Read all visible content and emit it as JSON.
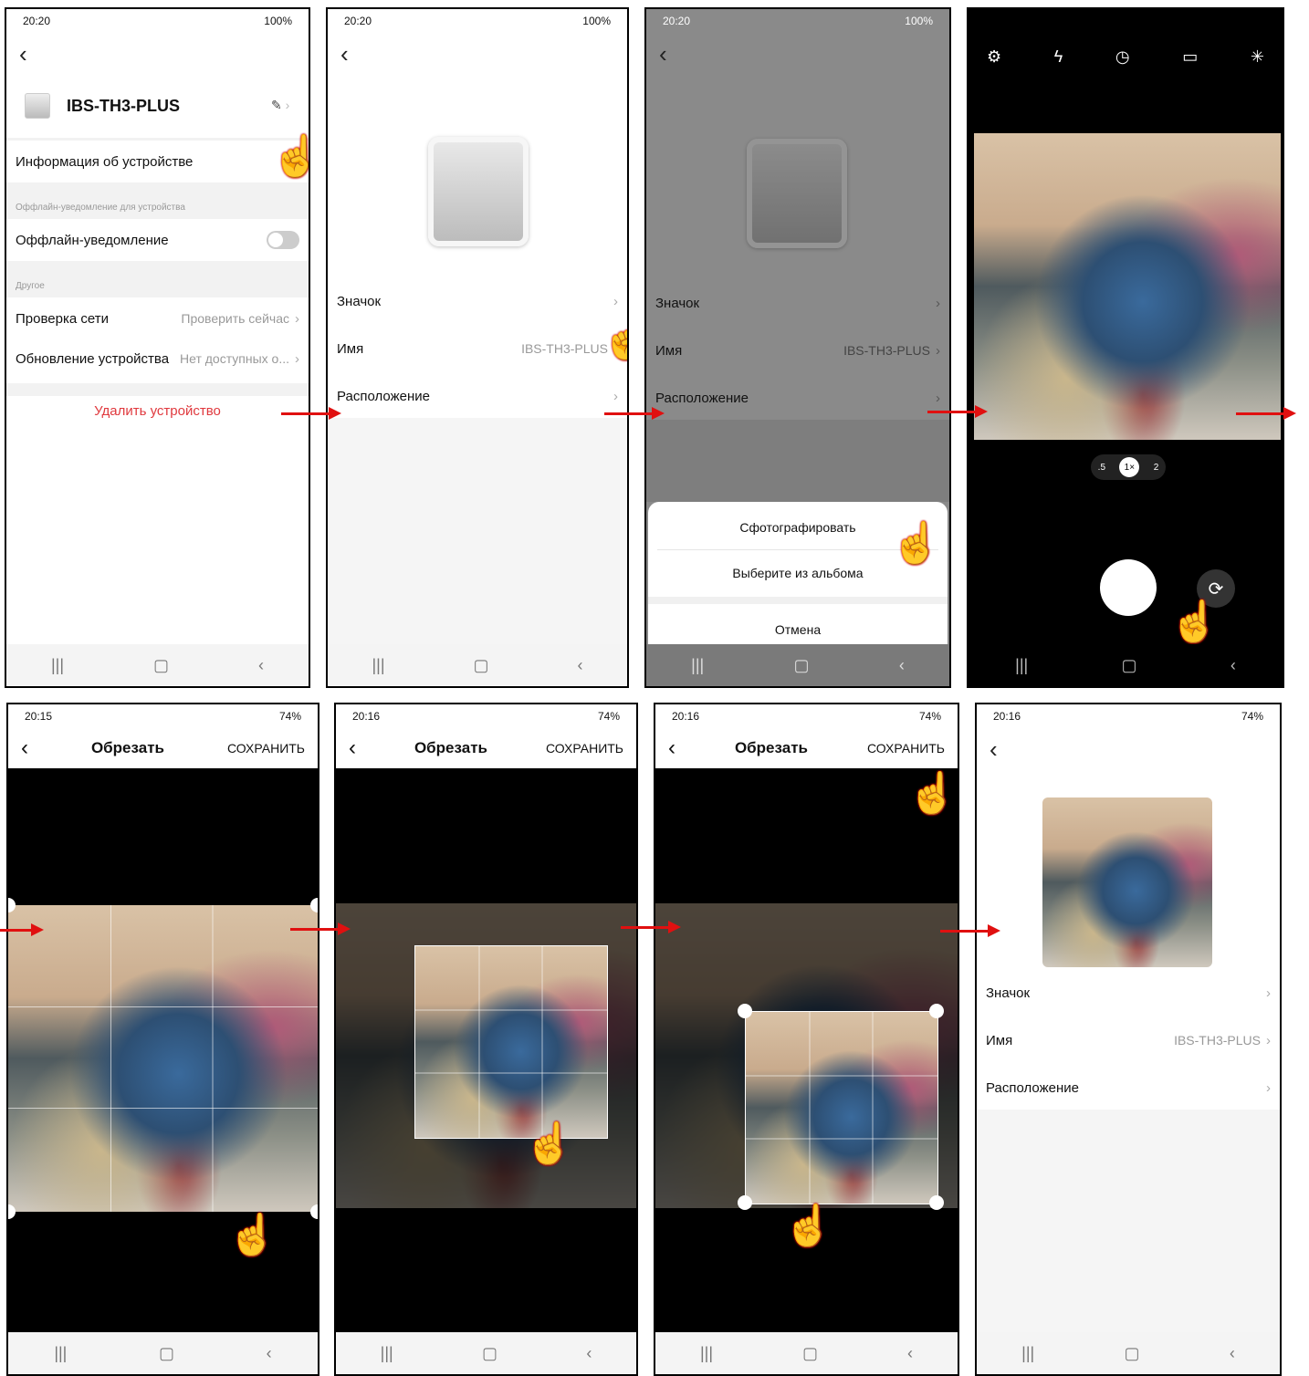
{
  "panels": {
    "p1": {
      "time": "20:20",
      "battery": "100%",
      "device_name": "IBS-TH3-PLUS",
      "info": "Информация об устройстве",
      "offline_section": "Оффлайн-уведомление для устройства",
      "offline_label": "Оффлайн-уведомление",
      "other_section": "Другое",
      "network_check": "Проверка сети",
      "network_check_value": "Проверить сейчас",
      "update": "Обновление устройства",
      "update_value": "Нет доступных о...",
      "delete": "Удалить устройство"
    },
    "p2": {
      "time": "20:20",
      "battery": "100%",
      "icon_label": "Значок",
      "name_label": "Имя",
      "name_value": "IBS-TH3-PLUS",
      "location_label": "Расположение"
    },
    "p3": {
      "time": "20:20",
      "battery": "100%",
      "icon_label": "Значок",
      "name_label": "Имя",
      "name_value": "IBS-TH3-PLUS",
      "location_label": "Расположение",
      "take_photo": "Сфотографировать",
      "choose_album": "Выберите из альбома",
      "cancel": "Отмена"
    },
    "p4": {
      "zoom_a": ".5",
      "zoom_b": "1×",
      "zoom_c": "2"
    },
    "p5": {
      "time": "20:15",
      "battery": "74%",
      "title": "Обрезать",
      "save": "СОХРАНИТЬ"
    },
    "p6": {
      "time": "20:16",
      "battery": "74%",
      "title": "Обрезать",
      "save": "СОХРАНИТЬ"
    },
    "p7": {
      "time": "20:16",
      "battery": "74%",
      "title": "Обрезать",
      "save": "СОХРАНИТЬ"
    },
    "p8": {
      "time": "20:16",
      "battery": "74%",
      "icon_label": "Значок",
      "name_label": "Имя",
      "name_value": "IBS-TH3-PLUS",
      "location_label": "Расположение"
    }
  },
  "nav": {
    "recent": "|||",
    "home": "▢",
    "back": "‹"
  },
  "icons": {
    "back": "back-arrow-icon",
    "pointer": "pointing-hand-icon",
    "arrow": "red-arrow-icon"
  }
}
